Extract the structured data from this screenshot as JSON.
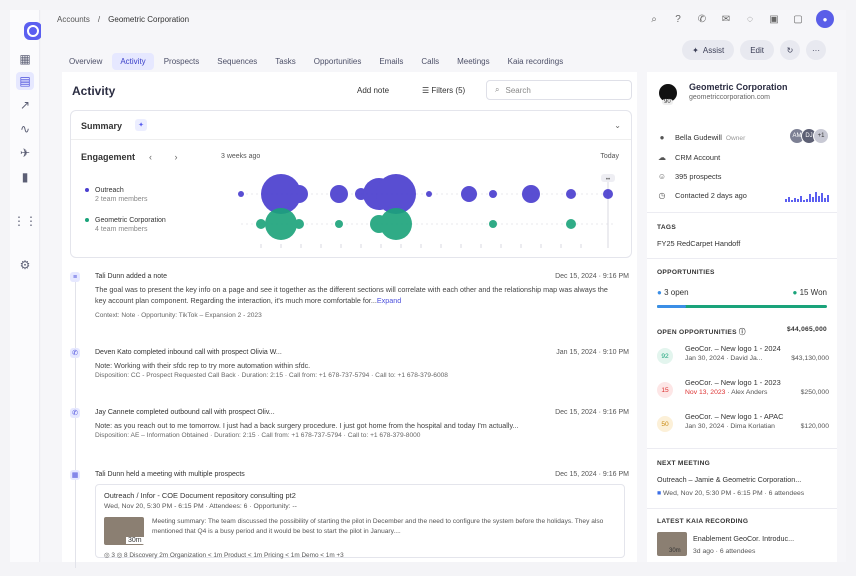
{
  "breadcrumb": {
    "root": "Accounts",
    "sep": "/",
    "current": "Geometric Corporation"
  },
  "user_initial": "●",
  "tabs": [
    "Overview",
    "Activity",
    "Prospects",
    "Sequences",
    "Tasks",
    "Opportunities",
    "Emails",
    "Calls",
    "Meetings",
    "Kaia recordings"
  ],
  "actions": {
    "assist": "Assist",
    "edit": "Edit"
  },
  "activity": {
    "title": "Activity",
    "add_note": "Add note",
    "filters": "Filters (5)",
    "search_placeholder": "Search",
    "summary": {
      "title": "Summary",
      "badge": "✦"
    },
    "engagement": {
      "title": "Engagement",
      "nav": "‹ ›",
      "start_label": "3 weeks ago",
      "end_label": "Today",
      "end_badge": "••",
      "series": [
        {
          "name": "Outreach",
          "sub": "2 team members",
          "color": "#4b3fcf"
        },
        {
          "name": "Geometric Corporation",
          "sub": "4 team members",
          "color": "#1aa37a"
        }
      ]
    },
    "feed": [
      {
        "icon": "≡",
        "title": "Tali Dunn added a note",
        "date": "Dec 15, 2024 · 9:16 PM",
        "body": "The goal was to present the key info on a page and see it together as the different sections will correlate with each other and the relationship map was always the key account plan component. Regarding the interaction, it's much more comfortable for...",
        "expand": "Expand",
        "meta": "Context: Note   ·   Opportunity: TikTok – Expansion 2 - 2023"
      },
      {
        "icon": "✆",
        "title": "Deven Kato completed inbound call with prospect Olivia W...",
        "date": "Jan 15, 2024 · 9:10 PM",
        "body": "Note: Working with their sfdc rep to try more automation within sfdc.",
        "meta": "Disposition: CC - Prospect Requested Call Back   ·   Duration: 2:15   ·   Call from: +1 678-737-5794   ·   Call to: +1 678-379-6008"
      },
      {
        "icon": "✆",
        "title": "Jay Cannete completed outbound call with prospect Oliv...",
        "date": "Dec 15, 2024 · 9:16 PM",
        "body": "Note: as you reach out to me tomorrow. I just had a back surgery procedure. I just got home from the hospital and today I'm actually...",
        "meta": "Disposition: AE – Information Obtained   ·   Duration: 2:15   ·   Call from: +1 678-737-5794   ·   Call to: +1 678-379-8000"
      },
      {
        "icon": "▦",
        "title": "Tali Dunn held a meeting with multiple prospects",
        "date": "Dec 15, 2024 · 9:16 PM",
        "meeting": {
          "title": "Outreach / Infor - COE Document repository consulting pt2",
          "sub": "Wed, Nov 20, 5:30 PM - 6:15 PM   ·   Attendees: 6   ·   Opportunity: --",
          "duration": "30m",
          "summary": "Meeting summary: The team discussed the possibility of starting the pilot in December and the need to configure the system before the holidays. They also mentioned that Q4 is a busy period and it would be best to start the pilot in January....",
          "chips": "◎ 3   ◎ 8     Discovery 2m     Organization < 1m     Product < 1m     Pricing < 1m     Demo < 1m     +3"
        }
      }
    ]
  },
  "account": {
    "name": "Geometric Corporation",
    "url": "geometriccorporation.com",
    "score": "90",
    "owner_name": "Bella Gudewill",
    "owner_role": "Owner",
    "avatars": [
      "AM",
      "DJ",
      "+1"
    ],
    "crm": "CRM Account",
    "prospects": "395 prospects",
    "contacted": "Contacted 2 days ago",
    "tags_header": "TAGS",
    "tag": "FY25 RedCarpet Handoff",
    "opps_header": "OPPORTUNITIES",
    "open": "3 open",
    "won": "15 Won",
    "open_fraction": 0.17,
    "open_opps_header": "OPEN OPPORTUNITIES",
    "open_opps_total": "$44,065,000",
    "open_opps": [
      {
        "score": "92",
        "name": "GeoCor. – New logo 1 - 2024",
        "date": "Jan 30, 2024",
        "owner": "David Ja...",
        "amount": "$43,130,000",
        "overdue": false,
        "color": "#1aa37a",
        "bg": "#e3f5ee"
      },
      {
        "score": "15",
        "name": "GeoCor. – New logo 1 - 2023",
        "date": "Nov 13, 2023",
        "owner": "Alex Anders",
        "amount": "$250,000",
        "overdue": true,
        "color": "#d33",
        "bg": "#fde6e6"
      },
      {
        "score": "50",
        "name": "GeoCor. – New logo 1 - APAC",
        "date": "Jan 30, 2024",
        "owner": "Dima Korlatian",
        "amount": "$120,000",
        "overdue": false,
        "color": "#c98a12",
        "bg": "#fcf0d8"
      }
    ],
    "next_meeting_header": "NEXT MEETING",
    "next_meeting_title": "Outreach – Jamie & Geometric Corporation...",
    "next_meeting_sub": "Wed, Nov 20, 5:30 PM - 6:15 PM   ·   6 attendees",
    "kaia_header": "LATEST KAIA RECORDING",
    "kaia_title": "Enablement GeoCor. Introduc...",
    "kaia_sub": "3d ago   ·   6 attendees",
    "kaia_duration": "30m"
  },
  "colors": {
    "accent": "#5b5ff0",
    "green": "#1aa37a",
    "purple": "#4b3fcf"
  }
}
